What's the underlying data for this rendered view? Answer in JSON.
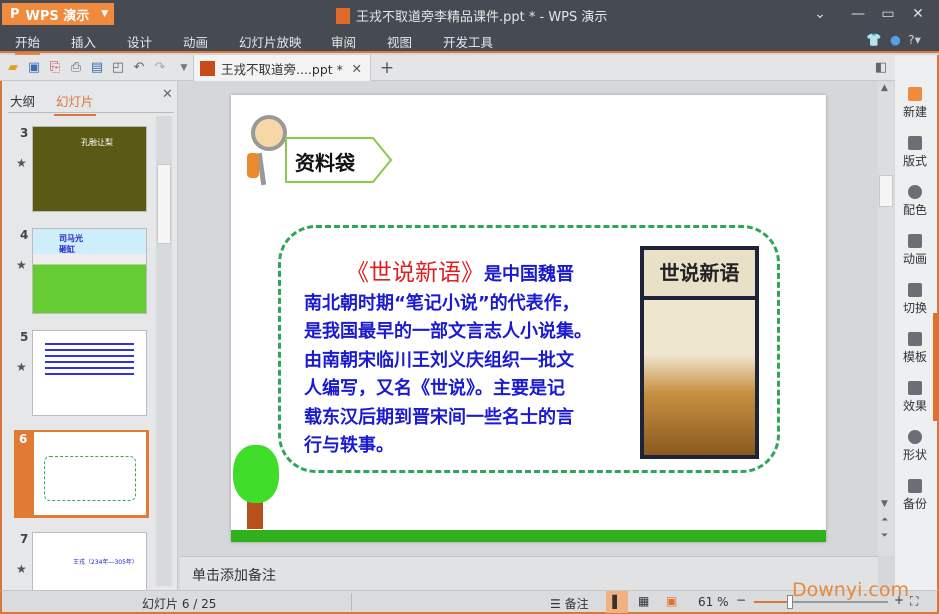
{
  "app": {
    "menu_button": "WPS 演示",
    "window_title": "王戎不取道旁李精品课件.ppt * - WPS 演示"
  },
  "menu": [
    "开始",
    "插入",
    "设计",
    "动画",
    "幻灯片放映",
    "审阅",
    "视图",
    "开发工具"
  ],
  "document_tab": "王戎不取道旁....ppt *",
  "left_panel": {
    "tabs": [
      "大纲",
      "幻灯片"
    ],
    "slides": [
      {
        "number": "3",
        "caption": "孔融让梨"
      },
      {
        "number": "4",
        "caption": "司马光砸缸"
      },
      {
        "number": "5"
      },
      {
        "number": "6"
      },
      {
        "number": "7",
        "caption": "王戎（234年—305年）"
      }
    ]
  },
  "slide": {
    "label": "资料袋",
    "book_title": "《世说新语》",
    "lines": [
      "是中国魏晋",
      "南北朝时期“笔记小说”的代表作，",
      "是我国最早的一部文言志人小说集。",
      "由南朝宋临川王刘义庆组织一批文",
      "人编写，又名《世说》。主要是记",
      "载东汉后期到晋宋间一些名士的言",
      "行与轶事。"
    ],
    "book_cover_text": "世说新语"
  },
  "notes_placeholder": "单击添加备注",
  "right_sidebar": [
    "新建",
    "版式",
    "配色",
    "动画",
    "切换",
    "模板",
    "效果",
    "形状",
    "备份"
  ],
  "status": {
    "slide_counter": "幻灯片 6 / 25",
    "notes_label": "备注",
    "zoom": "61 %",
    "zoom_percent": 61
  },
  "watermark": "Downyi.com",
  "colors": {
    "accent": "#d9773a",
    "title_bar": "#454a53",
    "text_blue": "#1a1ad0",
    "text_red": "#e02020",
    "green": "#2fb01c"
  }
}
